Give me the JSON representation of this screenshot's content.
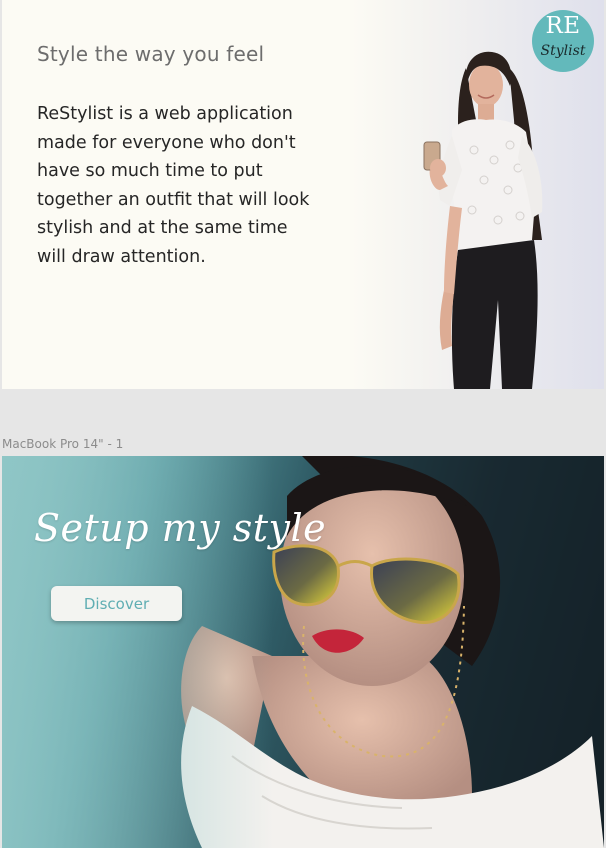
{
  "frame1": {
    "heading": "Style the way you feel",
    "body": "ReStylist is a web application made for everyone who don't have so much time to put together an outfit that will look stylish and at the same time will draw attention.",
    "logo": {
      "top": "RE",
      "bottom": "Stylist",
      "color": "#63b9bb"
    },
    "background": "#fcfbf4"
  },
  "frame2": {
    "label": "MacBook Pro 14\" - 1",
    "hero_title": "Setup my style",
    "discover_label": "Discover",
    "accent": "#60aeb3"
  }
}
